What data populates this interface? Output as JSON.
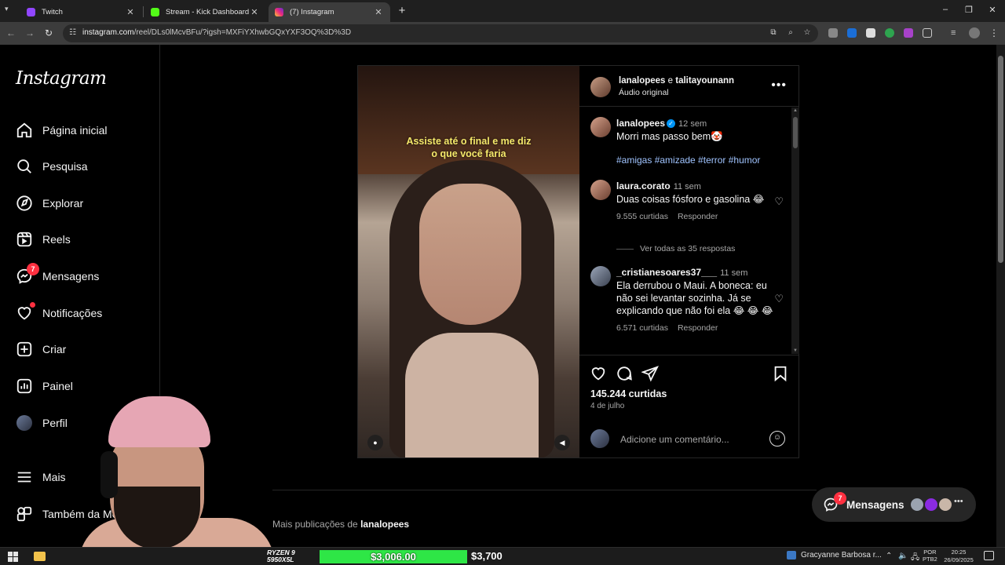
{
  "browser": {
    "tabs": [
      {
        "title": "Twitch",
        "favicon_color": "#9146ff",
        "active": false
      },
      {
        "title": "Stream - Kick Dashboard",
        "favicon_color": "#53fc18",
        "active": false
      },
      {
        "title": "(7) Instagram",
        "favicon_color": "#e1306c",
        "active": true
      }
    ],
    "url_host": "instagram.com",
    "url_path": "/reel/DLs0lMcvBFu/?igsh=MXFiYXhwbGQxYXF3OQ%3D%3D",
    "icons": [
      "back-icon",
      "forward-icon",
      "reload-icon",
      "site-info-icon",
      "install-icon",
      "zoom-icon",
      "bookmark-star-icon",
      "extensions-icon",
      "profile-icon",
      "menu-icon"
    ]
  },
  "instagram": {
    "logo": "Instagram",
    "nav": [
      {
        "label": "Página inicial",
        "icon": "home-icon"
      },
      {
        "label": "Pesquisa",
        "icon": "search-icon"
      },
      {
        "label": "Explorar",
        "icon": "compass-icon"
      },
      {
        "label": "Reels",
        "icon": "reels-icon"
      },
      {
        "label": "Mensagens",
        "icon": "messenger-icon",
        "badge": "7"
      },
      {
        "label": "Notificações",
        "icon": "heart-icon",
        "dot": true
      },
      {
        "label": "Criar",
        "icon": "plus-square-icon"
      },
      {
        "label": "Painel",
        "icon": "dashboard-icon"
      },
      {
        "label": "Perfil",
        "icon": "avatar"
      },
      {
        "label": "Mais",
        "icon": "hamburger-icon"
      },
      {
        "label": "Também da Meta",
        "icon": "meta-apps-icon"
      }
    ],
    "post": {
      "video_caption_line1": "Assiste até o final e me diz",
      "video_caption_line2": "o que você faria",
      "header_user1": "lanalopees",
      "header_joiner": "e",
      "header_user2": "talitayounann",
      "audio": "Áudio original",
      "caption": {
        "user": "lanalopees",
        "time": "12 sem",
        "text": "Morri mas passo bem🤡",
        "hashtags": "#amigas #amizade #terror #humor"
      },
      "comments": [
        {
          "user": "laura.corato",
          "time": "11 sem",
          "text": "Duas coisas fósforo e gasolina 😂",
          "likes": "9.555 curtidas",
          "reply": "Responder",
          "view_replies": "Ver todas as 35 respostas"
        },
        {
          "user": "_cristianesoares37___",
          "time": "11 sem",
          "text": "Ela derrubou o Maui. A boneca: eu não sei levantar sozinha. Já se explicando que não foi ela 😂 😂 😂",
          "likes": "6.571 curtidas",
          "reply": "Responder"
        }
      ],
      "likes_total": "145.244 curtidas",
      "date": "4 de julho",
      "add_comment_placeholder": "Adicione um comentário..."
    },
    "more_posts_prefix": "Mais publicações de",
    "more_posts_user": "lanalopees",
    "messages_pill": {
      "label": "Mensagens",
      "badge": "7"
    }
  },
  "taskbar": {
    "cpu_line1": "RYZEN 9",
    "cpu_line2": "5950X5L",
    "goal_current": "$3,006.00",
    "goal_target": "$3,700",
    "app_title": "Gracyanne Barbosa r...",
    "lang_line1": "POR",
    "lang_line2": "PTB2",
    "time": "20:25",
    "date": "26/09/2025"
  }
}
